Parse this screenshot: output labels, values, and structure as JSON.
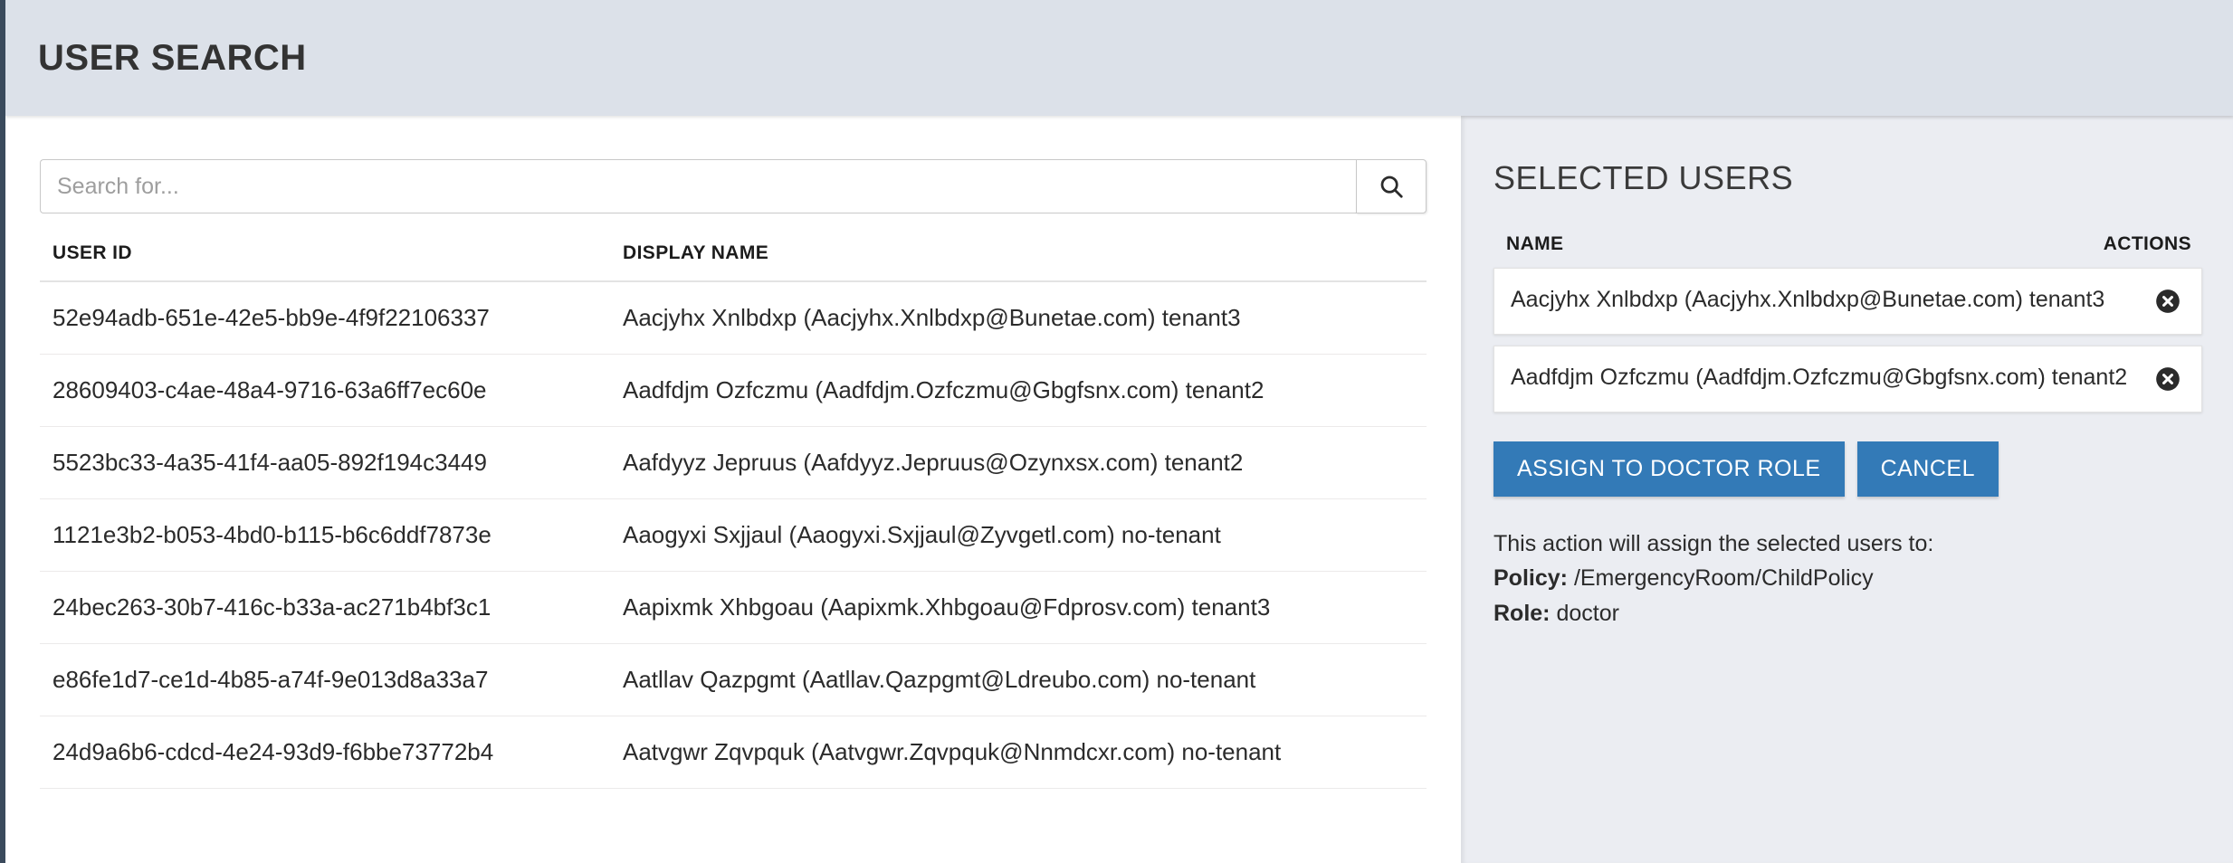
{
  "header": {
    "title": "User Search"
  },
  "search": {
    "placeholder": "Search for...",
    "value": "",
    "button_icon": "search-icon"
  },
  "results": {
    "columns": [
      "USER ID",
      "DISPLAY NAME"
    ],
    "rows": [
      {
        "user_id": "52e94adb-651e-42e5-bb9e-4f9f22106337",
        "display_name": "Aacjyhx Xnlbdxp (Aacjyhx.Xnlbdxp@Bunetae.com) tenant3"
      },
      {
        "user_id": "28609403-c4ae-48a4-9716-63a6ff7ec60e",
        "display_name": "Aadfdjm Ozfczmu (Aadfdjm.Ozfczmu@Gbgfsnx.com) tenant2"
      },
      {
        "user_id": "5523bc33-4a35-41f4-aa05-892f194c3449",
        "display_name": "Aafdyyz Jepruus (Aafdyyz.Jepruus@Ozynxsx.com) tenant2"
      },
      {
        "user_id": "1121e3b2-b053-4bd0-b115-b6c6ddf7873e",
        "display_name": "Aaogyxi Sxjjaul (Aaogyxi.Sxjjaul@Zyvgetl.com) no-tenant"
      },
      {
        "user_id": "24bec263-30b7-416c-b33a-ac271b4bf3c1",
        "display_name": "Aapixmk Xhbgoau (Aapixmk.Xhbgoau@Fdprosv.com) tenant3"
      },
      {
        "user_id": "e86fe1d7-ce1d-4b85-a74f-9e013d8a33a7",
        "display_name": "Aatllav Qazpgmt (Aatllav.Qazpgmt@Ldreubo.com) no-tenant"
      },
      {
        "user_id": "24d9a6b6-cdcd-4e24-93d9-f6bbe73772b4",
        "display_name": "Aatvgwr Zqvpquk (Aatvgwr.Zqvpquk@Nnmdcxr.com) no-tenant"
      }
    ]
  },
  "selected": {
    "title": "Selected Users",
    "columns": {
      "name": "NAME",
      "actions": "ACTIONS"
    },
    "items": [
      {
        "label": "Aacjyhx Xnlbdxp (Aacjyhx.Xnlbdxp@Bunetae.com) tenant3",
        "remove_icon": "remove-circle-icon"
      },
      {
        "label": "Aadfdjm Ozfczmu (Aadfdjm.Ozfczmu@Gbgfsnx.com) tenant2",
        "remove_icon": "remove-circle-icon"
      }
    ],
    "buttons": {
      "assign": "Assign to doctor role",
      "cancel": "Cancel"
    },
    "footnote": {
      "intro": "This action will assign the selected users to:",
      "policy_label": "Policy:",
      "policy_value": "/EmergencyRoom/ChildPolicy",
      "role_label": "Role:",
      "role_value": "doctor"
    }
  },
  "colors": {
    "header_bg": "#dce1e9",
    "right_pane_bg": "#ebedf2",
    "primary_button": "#337ab7",
    "left_border": "#3a4a5c"
  }
}
